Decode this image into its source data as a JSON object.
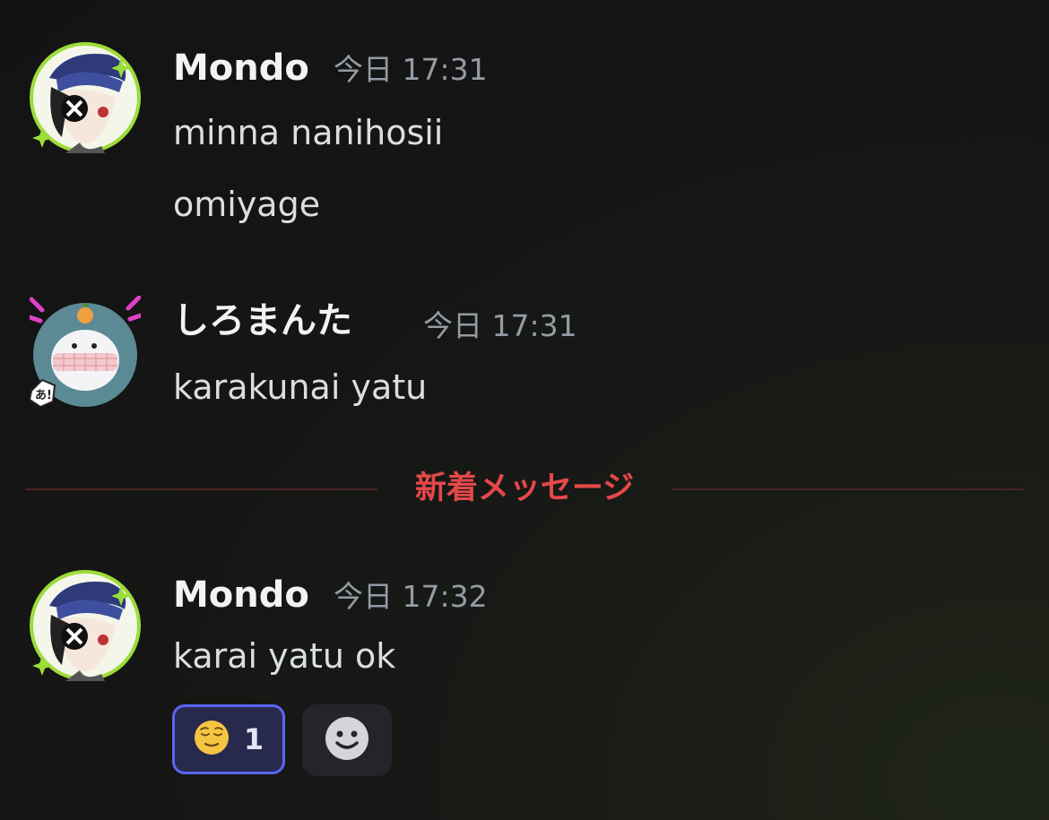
{
  "messages": [
    {
      "author": "Mondo",
      "timestamp": "今日 17:31",
      "lines": [
        "minna nanihosii",
        "omiyage"
      ]
    },
    {
      "author": "しろまんた",
      "timestamp": "今日 17:31",
      "lines": [
        "karakunai yatu"
      ]
    },
    {
      "author": "Mondo",
      "timestamp": "今日 17:32",
      "lines": [
        "karai yatu ok"
      ],
      "reactions": [
        {
          "emoji": "relieved-face",
          "count": "1"
        }
      ]
    }
  ],
  "divider": {
    "label": "新着メッセージ"
  },
  "colors": {
    "divider_label": "#e5484a",
    "reaction_border": "#5865f2",
    "username": "#f2f3f5",
    "timestamp": "#949ba4"
  },
  "icons": {
    "add_reaction": "smiley-face-icon"
  }
}
